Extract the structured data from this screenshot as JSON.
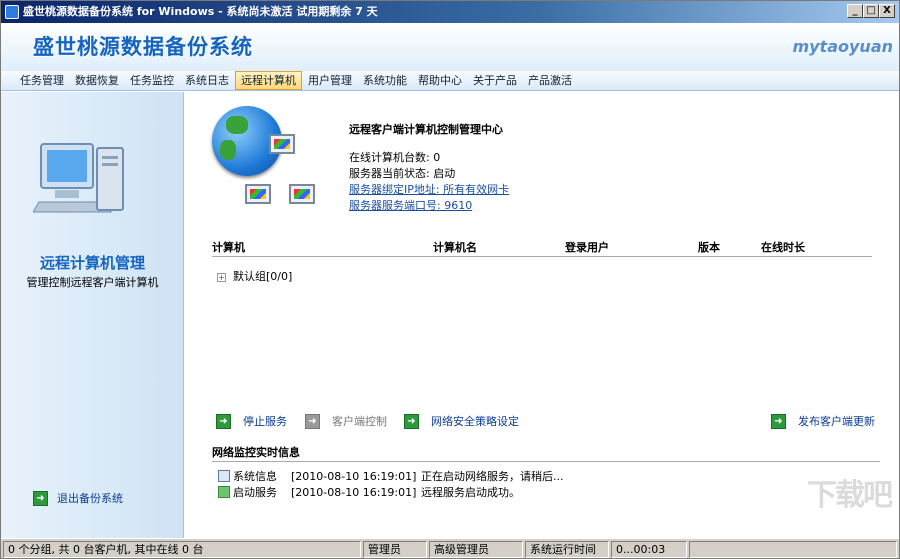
{
  "window": {
    "title": "盛世桃源数据备份系统 for Windows - 系统尚未激活 试用期剩余 7 天",
    "controls": {
      "minimize": "_",
      "maximize": "□",
      "close": "X"
    }
  },
  "header": {
    "app_title": "盛世桃源数据备份系统",
    "brand": "mytaoyuan"
  },
  "menu": [
    "任务管理",
    "数据恢复",
    "任务监控",
    "系统日志",
    "远程计算机",
    "用户管理",
    "系统功能",
    "帮助中心",
    "关于产品",
    "产品激活"
  ],
  "sidebar": {
    "title": "远程计算机管理",
    "subtitle": "管理控制远程客户端计算机",
    "exit": "退出备份系统"
  },
  "info": {
    "title": "远程客户端计算机控制管理中心",
    "online_count": "在线计算机台数: 0",
    "server_status": "服务器当前状态: 启动",
    "bind_ip": "服务器绑定IP地址: 所有有效网卡",
    "port": "服务器服务端口号: 9610"
  },
  "table": {
    "headers": [
      "计算机",
      "计算机名",
      "登录用户",
      "版本",
      "在线时长"
    ],
    "group": "默认组[0/0]"
  },
  "actions": {
    "stop": "停止服务",
    "client": "客户端控制",
    "security": "网络安全策略设定",
    "publish": "发布客户端更新"
  },
  "log": {
    "title": "网络监控实时信息",
    "rows": [
      {
        "type": "系统信息",
        "time": "[2010-08-10 16:19:01]",
        "msg": "正在启动网络服务，请稍后..."
      },
      {
        "type": "启动服务",
        "time": "[2010-08-10 16:19:01]",
        "msg": "远程服务启动成功。"
      }
    ]
  },
  "status": {
    "groups": "0 个分组, 共 0 台客户机, 其中在线 0 台",
    "admin": "管理员",
    "senior": "高级管理员",
    "runtime_label": "系统运行时间",
    "runtime": "0...00:03"
  },
  "watermark": "下载吧"
}
